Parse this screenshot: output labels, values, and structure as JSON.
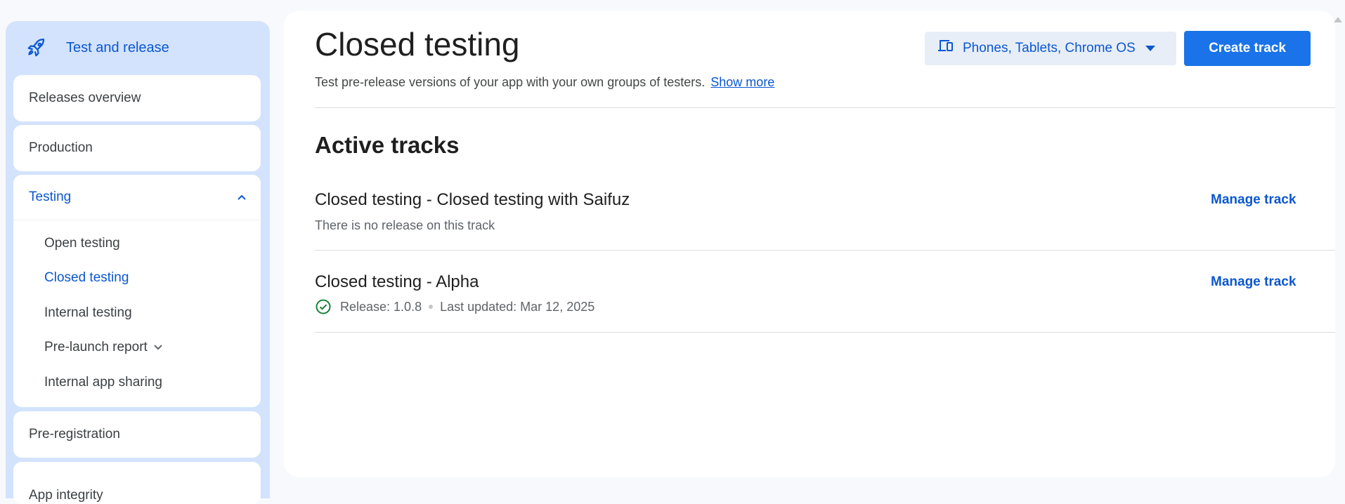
{
  "sidebar": {
    "header_label": "Test and release",
    "header_icon": "rocket-icon",
    "items": [
      {
        "label": "Releases overview"
      },
      {
        "label": "Production"
      },
      {
        "label": "Testing"
      },
      {
        "label": "Pre-registration"
      }
    ],
    "testing_subitems": [
      {
        "label": "Open testing"
      },
      {
        "label": "Closed testing"
      },
      {
        "label": "Internal testing"
      },
      {
        "label": "Pre-launch report"
      },
      {
        "label": "Internal app sharing"
      }
    ],
    "truncated_item": "App integrity"
  },
  "header": {
    "title": "Closed testing",
    "description": "Test pre-release versions of your app with your own groups of testers.",
    "show_more": "Show more",
    "device_filter": "Phones, Tablets, Chrome OS",
    "create_button": "Create track"
  },
  "section": {
    "title": "Active tracks"
  },
  "tracks": [
    {
      "title": "Closed testing - Closed testing with Saifuz",
      "status": "There is no release on this track",
      "action": "Manage track"
    },
    {
      "title": "Closed testing - Alpha",
      "release": "Release: 1.0.8",
      "updated": "Last updated: Mar 12, 2025",
      "action": "Manage track"
    }
  ],
  "colors": {
    "accent": "#0b57d0",
    "primary_button": "#1a73e8",
    "sidebar_bg": "#d3e3fd",
    "success": "#188038"
  }
}
